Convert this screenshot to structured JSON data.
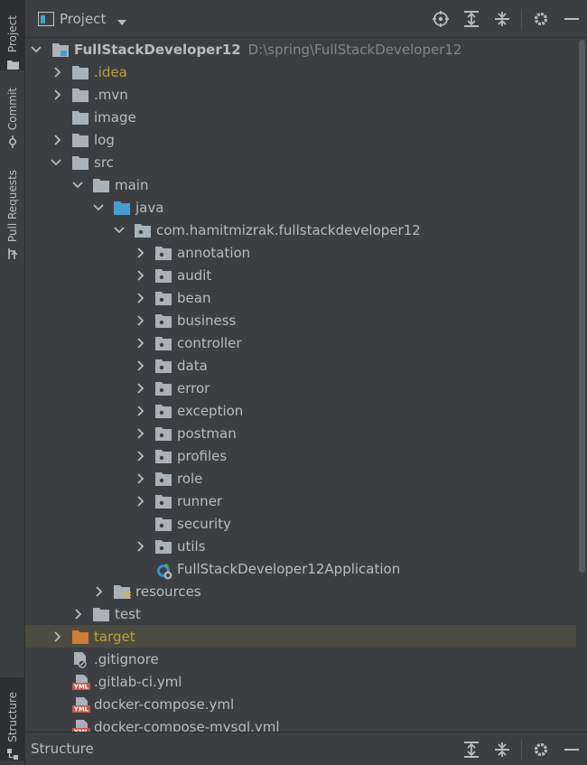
{
  "sidebar": {
    "tabs": [
      {
        "label": "Project",
        "icon": "folder-icon"
      },
      {
        "label": "Commit",
        "icon": "commit-icon"
      },
      {
        "label": "Pull Requests",
        "icon": "pull-request-icon"
      },
      {
        "label": "Structure",
        "icon": "structure-icon"
      }
    ]
  },
  "header": {
    "title": "Project",
    "tools": [
      "locate-icon",
      "expand-all-icon",
      "collapse-all-icon",
      "gear-icon",
      "minimize-icon"
    ]
  },
  "tree": {
    "root": {
      "label": "FullStackDeveloper12",
      "path": "D:\\spring\\FullStackDeveloper12"
    },
    "items": [
      {
        "label": ".idea"
      },
      {
        "label": ".mvn"
      },
      {
        "label": "image"
      },
      {
        "label": "log"
      },
      {
        "label": "src"
      },
      {
        "label": "main"
      },
      {
        "label": "java"
      },
      {
        "label": "com.hamitmizrak.fullstackdeveloper12"
      },
      {
        "label": "annotation"
      },
      {
        "label": "audit"
      },
      {
        "label": "bean"
      },
      {
        "label": "business"
      },
      {
        "label": "controller"
      },
      {
        "label": "data"
      },
      {
        "label": "error"
      },
      {
        "label": "exception"
      },
      {
        "label": "postman"
      },
      {
        "label": "profiles"
      },
      {
        "label": "role"
      },
      {
        "label": "runner"
      },
      {
        "label": "security"
      },
      {
        "label": "utils"
      },
      {
        "label": "FullStackDeveloper12Application"
      },
      {
        "label": "resources"
      },
      {
        "label": "test"
      },
      {
        "label": "target"
      },
      {
        "label": ".gitignore"
      },
      {
        "label": ".gitlab-ci.yml"
      },
      {
        "label": "docker-compose.yml"
      },
      {
        "label": "docker-compose-mysql.yml"
      }
    ]
  },
  "bottom": {
    "title": "Structure",
    "tools": [
      "expand-all-icon",
      "collapse-all-icon",
      "gear-icon",
      "minimize-icon"
    ]
  },
  "colors": {
    "background": "#3c3f41",
    "text": "#bbbbbb",
    "folder": "#a9b2b8",
    "source_folder": "#4a9cd0",
    "excluded_folder": "#d07a33",
    "excluded_text": "#b5a33d",
    "selected_row": "#4b4b3f",
    "yml": "#c1524f"
  }
}
